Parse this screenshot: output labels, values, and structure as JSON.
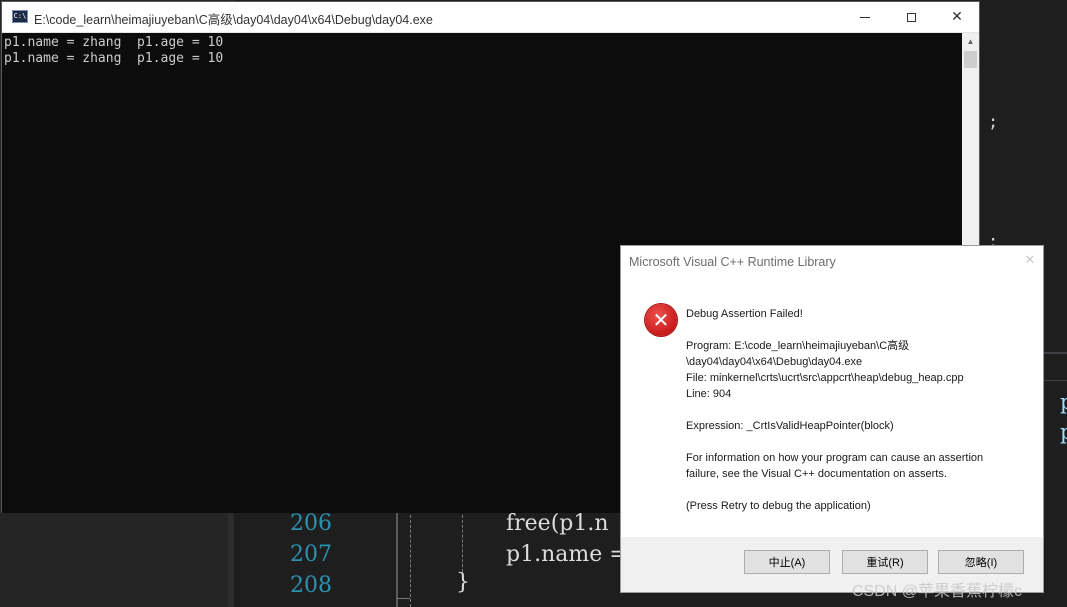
{
  "ide": {
    "line_numbers": [
      "206",
      "207",
      "208"
    ],
    "code_lines": [
      "free(p1.n",
      "p1.name =",
      "}"
    ],
    "stray_right": ";",
    "stray_right2": ":",
    "right_chars": [
      "p",
      "p"
    ]
  },
  "console": {
    "title": "E:\\code_learn\\heimajiuyeban\\C高级\\day04\\day04\\x64\\Debug\\day04.exe",
    "icon_label": "C:\\",
    "lines": [
      "p1.name = zhang  p1.age = 10",
      "p1.name = zhang  p1.age = 10"
    ],
    "controls": {
      "minimize": "—",
      "maximize": "☐",
      "close": "✕"
    }
  },
  "dialog": {
    "title": "Microsoft Visual C++ Runtime Library",
    "close": "✕",
    "heading": "Debug Assertion Failed!",
    "program": "Program: E:\\code_learn\\heimajiuyeban\\C高级\n\\day04\\day04\\x64\\Debug\\day04.exe\nFile: minkernel\\crts\\ucrt\\src\\appcrt\\heap\\debug_heap.cpp\nLine: 904",
    "expression": "Expression: _CrtIsValidHeapPointer(block)",
    "info": "For information on how your program can cause an assertion\nfailure, see the Visual C++ documentation on asserts.",
    "hint": "(Press Retry to debug the application)",
    "buttons": {
      "abort": "中止(A)",
      "retry": "重试(R)",
      "ignore": "忽略(I)"
    }
  },
  "watermark": "CSDN @苹果香蕉柠檬c"
}
